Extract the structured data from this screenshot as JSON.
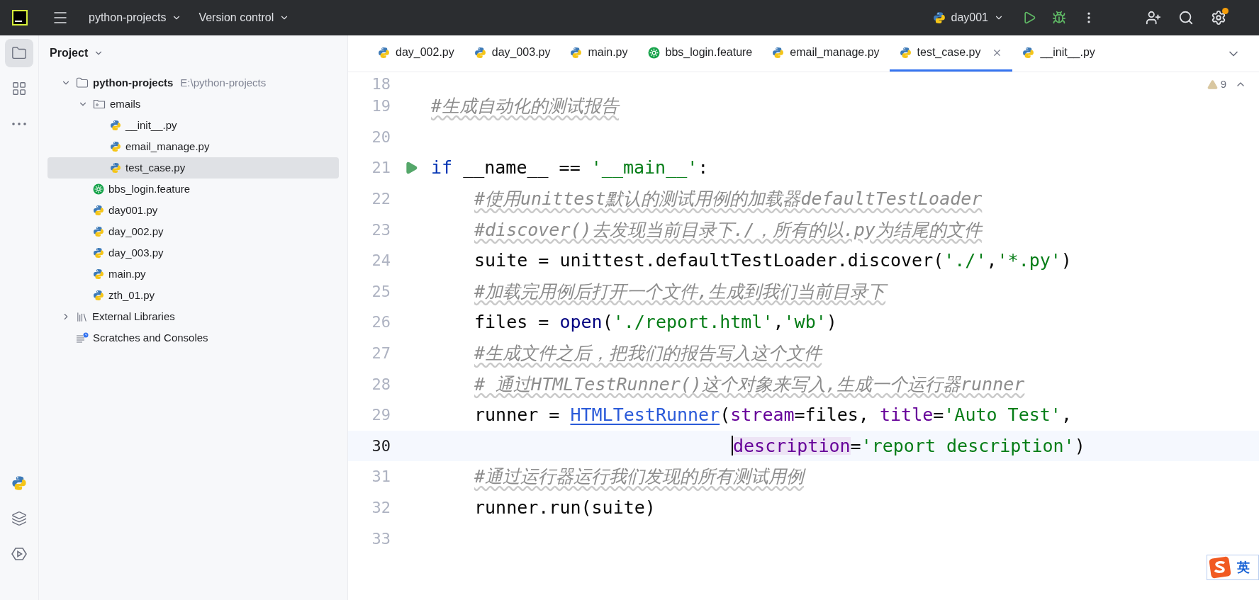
{
  "title_bar": {
    "project": "python-projects",
    "vcs": "Version control",
    "run_config": "day001"
  },
  "tool_strip": {
    "top": [
      {
        "kind": "folder",
        "selected": true
      },
      {
        "kind": "structure",
        "selected": false
      },
      {
        "kind": "more",
        "selected": false
      }
    ],
    "bottom": [
      {
        "kind": "python",
        "selected": false
      },
      {
        "kind": "layers",
        "selected": false
      },
      {
        "kind": "services",
        "selected": false
      }
    ]
  },
  "project_panel": {
    "title": "Project",
    "tree": [
      {
        "label": "python-projects",
        "hint": "E:\\python-projects",
        "kind": "folder",
        "expanded": true,
        "selected": false,
        "children": [
          {
            "label": "emails",
            "kind": "package",
            "expanded": true,
            "selected": false,
            "children": [
              {
                "label": "__init__.py",
                "kind": "python",
                "selected": false
              },
              {
                "label": "email_manage.py",
                "kind": "python",
                "selected": false
              },
              {
                "label": "test_case.py",
                "kind": "python",
                "selected": true
              }
            ]
          },
          {
            "label": "bbs_login.feature",
            "kind": "feature",
            "selected": false
          },
          {
            "label": "day001.py",
            "kind": "python",
            "selected": false
          },
          {
            "label": "day_002.py",
            "kind": "python",
            "selected": false
          },
          {
            "label": "day_003.py",
            "kind": "python",
            "selected": false
          },
          {
            "label": "main.py",
            "kind": "python",
            "selected": false
          },
          {
            "label": "zth_01.py",
            "kind": "python",
            "selected": false
          }
        ]
      },
      {
        "label": "External Libraries",
        "kind": "library",
        "expanded": false,
        "selected": false
      },
      {
        "label": "Scratches and Consoles",
        "kind": "scratches",
        "selected": false
      }
    ]
  },
  "tabs": [
    {
      "label": "day_002.py",
      "kind": "python",
      "selected": false
    },
    {
      "label": "day_003.py",
      "kind": "python",
      "selected": false
    },
    {
      "label": "main.py",
      "kind": "python",
      "selected": false
    },
    {
      "label": "bbs_login.feature",
      "kind": "feature",
      "selected": false
    },
    {
      "label": "email_manage.py",
      "kind": "python",
      "selected": false
    },
    {
      "label": "test_case.py",
      "kind": "python",
      "selected": true
    },
    {
      "label": "__init__.py",
      "kind": "python",
      "selected": false
    }
  ],
  "inspections": {
    "warnings": "9"
  },
  "code": [
    {
      "number": "18",
      "current": false
    },
    {
      "number": "19",
      "current": false,
      "indented": false,
      "tokens": [
        {
          "kind": "comment",
          "text": "#生成自动化的测试报告"
        }
      ]
    },
    {
      "number": "20",
      "current": false
    },
    {
      "number": "21",
      "current": false,
      "runnable": true,
      "indented": false,
      "tokens": [
        {
          "kind": "keyword",
          "text": "if"
        },
        {
          "kind": "plain",
          "text": " __name__ == "
        },
        {
          "kind": "string",
          "text": "'__main__'"
        },
        {
          "kind": "plain",
          "text": ":"
        }
      ]
    },
    {
      "number": "22",
      "current": false,
      "indented": true,
      "tokens": [
        {
          "kind": "comment",
          "text": "#使用unittest默认的测试用例的加载器defaultTestLoader"
        }
      ]
    },
    {
      "number": "23",
      "current": false,
      "indented": true,
      "tokens": [
        {
          "kind": "comment",
          "text": "#discover()去发现当前目录下./，所有的以.py为结尾的文件"
        }
      ]
    },
    {
      "number": "24",
      "current": false,
      "indented": true,
      "tokens": [
        {
          "kind": "plain",
          "text": "suite = unittest.defaultTestLoader.discover("
        },
        {
          "kind": "string",
          "text": "'./'"
        },
        {
          "kind": "plain",
          "text": ","
        },
        {
          "kind": "string",
          "text": "'*.py'"
        },
        {
          "kind": "plain",
          "text": ")"
        }
      ]
    },
    {
      "number": "25",
      "current": false,
      "indented": true,
      "tokens": [
        {
          "kind": "comment",
          "text": "#加载完用例后打开一个文件,生成到我们当前目录下"
        }
      ]
    },
    {
      "number": "26",
      "current": false,
      "indented": true,
      "tokens": [
        {
          "kind": "plain",
          "text": "files = "
        },
        {
          "kind": "builtin",
          "text": "open"
        },
        {
          "kind": "plain",
          "text": "("
        },
        {
          "kind": "string",
          "text": "'./report.html'"
        },
        {
          "kind": "plain",
          "text": ","
        },
        {
          "kind": "string",
          "text": "'wb'"
        },
        {
          "kind": "plain",
          "text": ")"
        }
      ]
    },
    {
      "number": "27",
      "current": false,
      "indented": true,
      "tokens": [
        {
          "kind": "comment",
          "text": "#生成文件之后，把我们的报告写入这个文件"
        }
      ]
    },
    {
      "number": "28",
      "current": false,
      "indented": true,
      "tokens": [
        {
          "kind": "comment",
          "text": "# 通过HTMLTestRunner()这个对象来写入,生成一个运行器runner"
        }
      ]
    },
    {
      "number": "29",
      "current": false,
      "indented": true,
      "tokens": [
        {
          "kind": "plain",
          "text": "runner = "
        },
        {
          "kind": "link",
          "text": "HTMLTestRunner"
        },
        {
          "kind": "plain",
          "text": "("
        },
        {
          "kind": "param",
          "text": "stream"
        },
        {
          "kind": "plain",
          "text": "=files, "
        },
        {
          "kind": "param",
          "text": "title"
        },
        {
          "kind": "plain",
          "text": "="
        },
        {
          "kind": "string",
          "text": "'Auto Test'"
        },
        {
          "kind": "plain",
          "text": ","
        }
      ]
    },
    {
      "number": "30",
      "current": true,
      "continuation": true,
      "tokens": [
        {
          "kind": "param",
          "text": "description",
          "highlighted": true
        },
        {
          "kind": "plain",
          "text": "="
        },
        {
          "kind": "string",
          "text": "'report description'"
        },
        {
          "kind": "plain",
          "text": ")"
        }
      ]
    },
    {
      "number": "31",
      "current": false,
      "indented": true,
      "tokens": [
        {
          "kind": "comment",
          "text": "#通过运行器运行我们发现的所有测试用例"
        }
      ]
    },
    {
      "number": "32",
      "current": false,
      "indented": true,
      "tokens": [
        {
          "kind": "plain",
          "text": "runner.run(suite)"
        }
      ]
    },
    {
      "number": "33",
      "current": false
    }
  ],
  "ime_toolbar": {
    "label": "英"
  }
}
